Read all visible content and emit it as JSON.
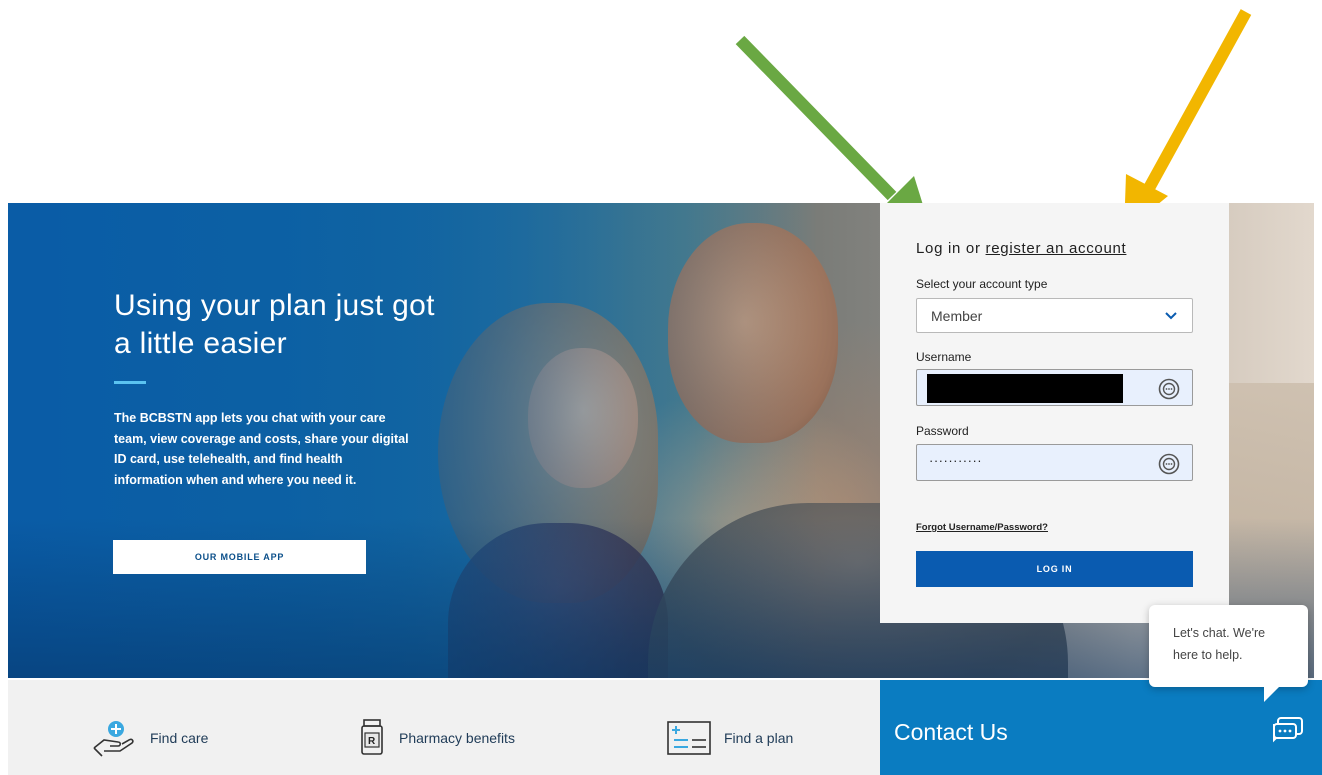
{
  "hero": {
    "title": "Using your plan just got a little easier",
    "description": "The BCBSTN app lets you chat with your care team, view coverage and costs, share your digital ID card, use telehealth, and find health information when and where you need it.",
    "cta_label": "OUR MOBILE APP"
  },
  "login": {
    "heading_prefix": "Log in or ",
    "register_link": "register an account",
    "account_type_label": "Select your account type",
    "account_type_value": "Member",
    "username_label": "Username",
    "password_label": "Password",
    "password_mask": "···········",
    "forgot_link": "Forgot Username/Password?",
    "login_button": "LOG IN"
  },
  "chat": {
    "bubble_text": "Let's chat. We're here to help."
  },
  "quick_links": [
    {
      "label": "Find care",
      "icon": "hand-plus-icon"
    },
    {
      "label": "Pharmacy benefits",
      "icon": "pill-bottle-icon"
    },
    {
      "label": "Find a plan",
      "icon": "plan-list-icon"
    }
  ],
  "contact": {
    "title": "Contact Us",
    "icon": "chat-icon"
  },
  "colors": {
    "primary_blue": "#0a5bb0",
    "contact_blue": "#0a7cc1",
    "accent_rule": "#5bc3f0",
    "arrow_green": "#6aa843",
    "arrow_yellow": "#f2b600"
  }
}
